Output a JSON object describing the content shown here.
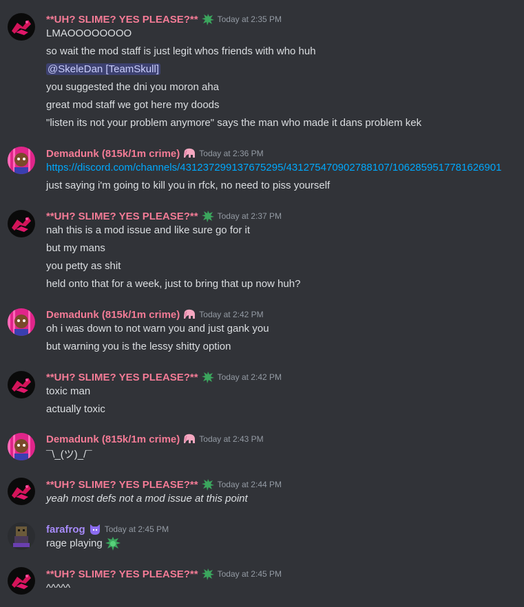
{
  "colors": {
    "background": "#313338",
    "text": "#dbdee1",
    "timestamp": "#949ba4",
    "slime_name": "#f47b96",
    "demadunk_name": "#f47b96",
    "farafrog_name": "#a78bfa",
    "link": "#00a8fc",
    "mention_bg": "#3c4270"
  },
  "messages": [
    {
      "author": "**UH? SLIME? YES PLEASE?**",
      "role_icon": "splat-icon",
      "timestamp": "Today at 2:35 PM",
      "lines": [
        "LMAOOOOOOOO",
        "so wait the mod staff is just legit whos friends with who huh",
        "@SkeleDan [TeamSkull]",
        "you suggested the dni you moron aha",
        "great mod staff we got here my doods",
        "\"listen its not your problem anymore\" says the man who made it dans problem kek"
      ]
    },
    {
      "author": "Demadunk (815k/1m crime)",
      "role_icon": "elephant-icon",
      "timestamp": "Today at 2:36 PM",
      "lines": [
        "https://discord.com/channels/431237299137675295/431275470902788107/1062859517781626901",
        "just saying i'm going to kill you in rfck, no need to piss yourself"
      ]
    },
    {
      "author": "**UH? SLIME? YES PLEASE?**",
      "role_icon": "splat-icon",
      "timestamp": "Today at 2:37 PM",
      "lines": [
        "nah this is a mod issue and like sure go for it",
        "but my mans",
        "you petty as shit",
        "held onto that for a week, just to bring that up now huh?"
      ]
    },
    {
      "author": "Demadunk (815k/1m crime)",
      "role_icon": "elephant-icon",
      "timestamp": "Today at 2:42 PM",
      "lines": [
        "oh i was down to not warn you and just gank you",
        "but warning you is the lessy shitty option"
      ]
    },
    {
      "author": "**UH? SLIME? YES PLEASE?**",
      "role_icon": "splat-icon",
      "timestamp": "Today at 2:42 PM",
      "lines": [
        "toxic man",
        "actually toxic"
      ]
    },
    {
      "author": "Demadunk (815k/1m crime)",
      "role_icon": "elephant-icon",
      "timestamp": "Today at 2:43 PM",
      "lines": [
        "¯\\_(ツ)_/¯"
      ]
    },
    {
      "author": "**UH? SLIME? YES PLEASE?**",
      "role_icon": "splat-icon",
      "timestamp": "Today at 2:44 PM",
      "lines": [
        "yeah most defs not a mod issue at this point"
      ]
    },
    {
      "author": "farafrog",
      "role_icon": "cat-badge-icon",
      "timestamp": "Today at 2:45 PM",
      "lines": [
        "rage playing"
      ]
    },
    {
      "author": "**UH? SLIME? YES PLEASE?**",
      "role_icon": "splat-icon",
      "timestamp": "Today at 2:45 PM",
      "lines": [
        "^^^^^"
      ]
    }
  ]
}
